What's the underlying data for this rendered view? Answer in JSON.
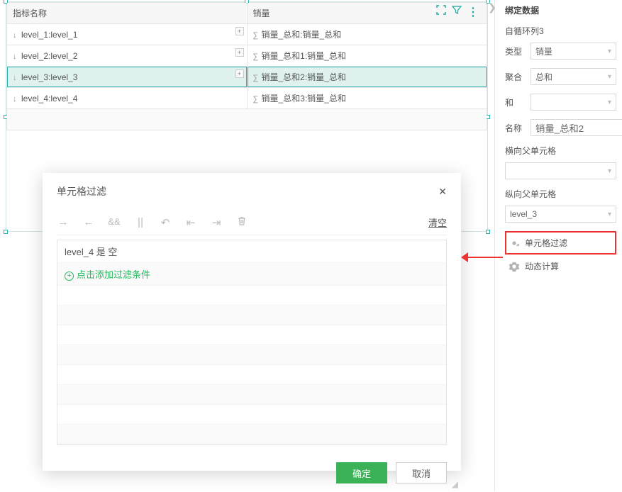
{
  "table": {
    "headers": [
      "指标名称",
      "销量"
    ],
    "rows": [
      {
        "dim": "level_1:level_1",
        "val": "销量_总和:销量_总和"
      },
      {
        "dim": "level_2:level_2",
        "val": "销量_总和1:销量_总和"
      },
      {
        "dim": "level_3:level_3",
        "val": "销量_总和2:销量_总和",
        "selected": true
      },
      {
        "dim": "level_4:level_4",
        "val": "销量_总和3:销量_总和"
      }
    ]
  },
  "panel": {
    "title": "绑定数据",
    "loop_label": "自循环列3",
    "type_label": "类型",
    "type_value": "销量",
    "agg_label": "聚合",
    "agg_value": "总和",
    "and_label": "和",
    "and_value": "",
    "name_label": "名称",
    "name_value": "销量_总和2",
    "hparent_label": "横向父单元格",
    "hparent_value": "",
    "vparent_label": "纵向父单元格",
    "vparent_value": "level_3",
    "cellfilter_label": "单元格过滤",
    "dyncalc_label": "动态计算"
  },
  "dialog": {
    "title": "单元格过滤",
    "clear": "清空",
    "condition": "level_4 是 空",
    "add_text": "点击添加过滤条件",
    "ok": "确定",
    "cancel": "取消"
  }
}
